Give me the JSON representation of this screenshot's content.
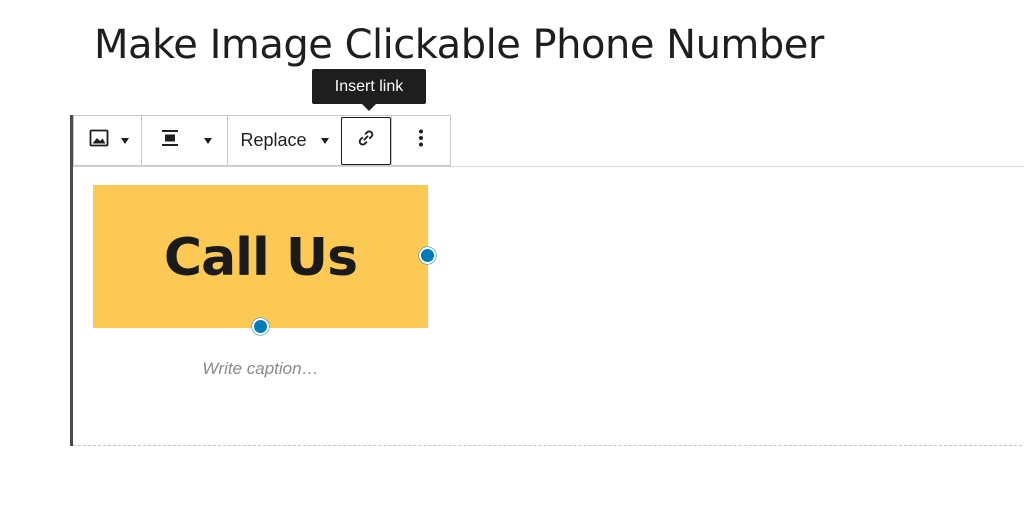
{
  "page": {
    "title": "Make Image Clickable Phone Number"
  },
  "toolbar": {
    "image_icon": "image-icon",
    "align_icon": "align-center-icon",
    "replace_label": "Replace",
    "link_icon": "link-icon",
    "more_icon": "more-vertical-icon",
    "tooltip": "Insert link"
  },
  "image_block": {
    "text": "Call Us",
    "background_color": "#fcc955",
    "handle_color": "#007cba",
    "caption_placeholder": "Write caption…"
  }
}
